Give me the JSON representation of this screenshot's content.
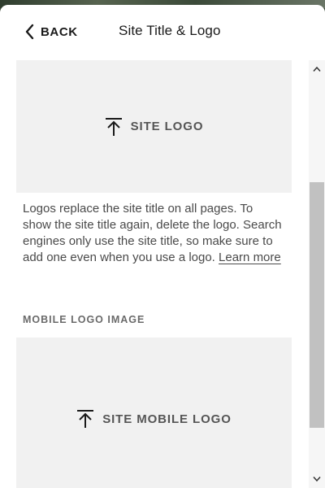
{
  "header": {
    "back_label": "BACK",
    "title": "Site Title & Logo"
  },
  "logo_upload": {
    "label": "SITE LOGO",
    "icon": "upload-icon"
  },
  "help": {
    "text": "Logos replace the site title on all pages. To show the site title again, delete the logo. Search engines only use the site title, so make sure to add one even when you use a logo. ",
    "link_label": "Learn more"
  },
  "mobile_section": {
    "label": "MOBILE LOGO IMAGE",
    "upload_label": "SITE MOBILE LOGO",
    "icon": "upload-icon"
  },
  "colors": {
    "panel_bg": "#ffffff",
    "upload_bg": "#f1f1f1",
    "text": "#1a1a1a",
    "muted_text": "#4a4a4a",
    "scroll_thumb": "#c1c1c1"
  },
  "scrollbar": {
    "position_fraction": 0.29
  }
}
